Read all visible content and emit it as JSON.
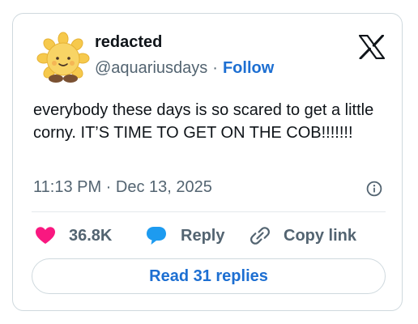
{
  "author": {
    "name": "redacted",
    "handle": "@aquariusdays",
    "separator": "·",
    "follow_label": "Follow"
  },
  "post": {
    "text": "everybody these days is so scared to get a little corny. IT’S TIME TO GET ON THE COB!!!!!!!",
    "timestamp": "11:13 PM · Dec 13, 2025"
  },
  "actions": {
    "like_count": "36.8K",
    "reply_label": "Reply",
    "copy_label": "Copy link"
  },
  "read_replies_label": "Read 31 replies",
  "colors": {
    "like": "#f91880",
    "reply": "#1d9bf0",
    "link": "#1d6fd2",
    "muted": "#536471"
  },
  "icons": {
    "avatar": "sun-plush-avatar",
    "brand": "x-logo-icon",
    "info": "info-icon",
    "like": "heart-icon",
    "reply": "speech-bubble-icon",
    "copy": "link-icon"
  }
}
